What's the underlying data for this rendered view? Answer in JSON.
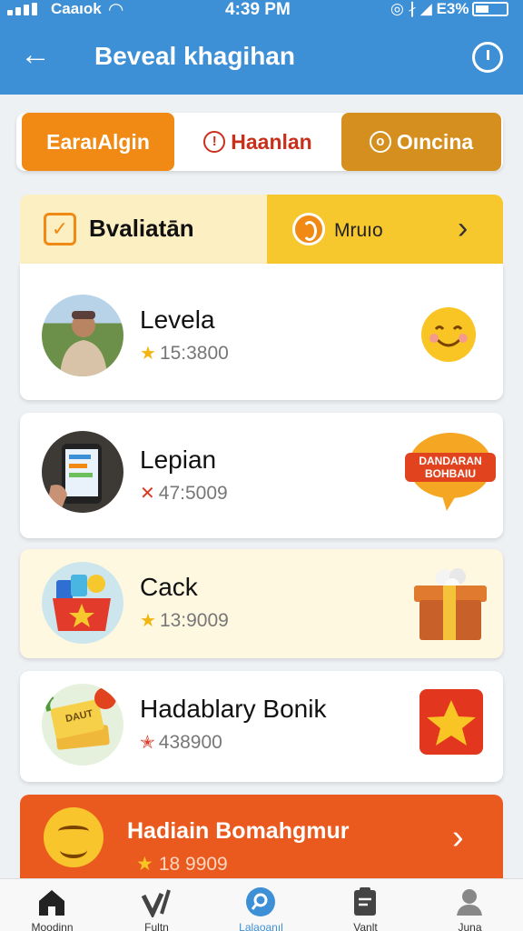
{
  "status_bar": {
    "carrier": "Caaıok",
    "time": "4:39 PM",
    "battery": "E3%"
  },
  "header": {
    "title": "Beveal khagihan"
  },
  "tabs": [
    {
      "label": "EaraıAlgin",
      "active": true
    },
    {
      "label": "Haanlan",
      "active": false
    },
    {
      "label": "Oıncina",
      "active": false
    }
  ],
  "section": {
    "title": "Bvaliatān",
    "link_label": "Mruıo"
  },
  "cards": [
    {
      "name": "Levela",
      "score": "15:3800",
      "badge": "smiley-emoji"
    },
    {
      "name": "Lepian",
      "score": "47:5009",
      "badge": "speech-bubble-sticker"
    },
    {
      "name": "Cack",
      "score": "13:9009",
      "badge": "gift-box"
    },
    {
      "name": "Hadablary Bonik",
      "score": "438900",
      "badge": "star-tile"
    }
  ],
  "badge_sticker_text": [
    "DANDARAN",
    "BOHBAIU"
  ],
  "card4_tag": "DAUT",
  "featured": {
    "title": "Hadiain Bomahgmur",
    "score": "18 9909"
  },
  "bottom_nav": [
    {
      "label": "Moodinn",
      "icon": "home-icon"
    },
    {
      "label": "Fultn",
      "icon": "check-icon"
    },
    {
      "label": "Lalaoanıl",
      "icon": "search-icon",
      "active": true
    },
    {
      "label": "Vanlt",
      "icon": "clipboard-icon"
    },
    {
      "label": "Juna",
      "icon": "profile-icon"
    }
  ],
  "colors": {
    "header": "#3d8fd6",
    "accent_orange": "#f08a14",
    "accent_gold": "#d48f1e",
    "banner": "#ea5a1f",
    "section_yellow": "#f7c72e"
  }
}
